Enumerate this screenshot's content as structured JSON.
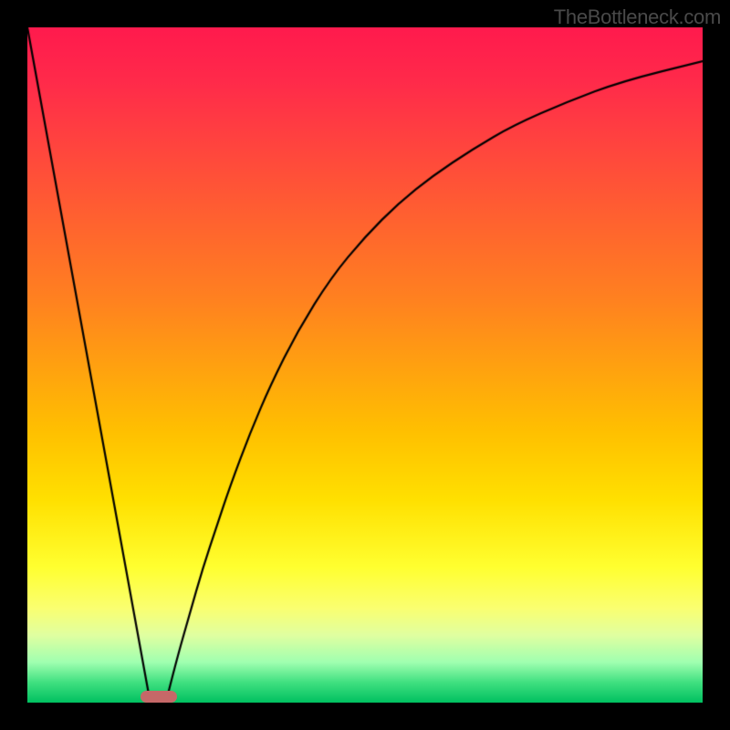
{
  "watermark": "TheBottleneck.com",
  "chart_data": {
    "type": "line",
    "title": "",
    "xlabel": "",
    "ylabel": "",
    "xlim": [
      0,
      100
    ],
    "ylim": [
      0,
      100
    ],
    "grid": false,
    "legend": false,
    "background": "red-to-green-vertical-gradient",
    "series": [
      {
        "name": "left-line",
        "type": "line",
        "x": [
          0,
          18.2
        ],
        "y": [
          100,
          0
        ]
      },
      {
        "name": "right-curve",
        "type": "line",
        "x": [
          20.5,
          22,
          24,
          26,
          28,
          30,
          33,
          36,
          40,
          45,
          50,
          55,
          60,
          66,
          72,
          80,
          88,
          100
        ],
        "y": [
          0,
          6,
          13,
          20,
          26,
          32,
          40,
          47,
          55,
          63,
          69,
          74,
          78,
          82,
          85.5,
          89,
          92,
          95
        ]
      }
    ],
    "marker": {
      "name": "min-marker",
      "shape": "rounded-rect",
      "color": "#c66868",
      "x_center": 19.4,
      "y": 0,
      "width_pct": 5.4,
      "height_pct": 1.8
    }
  }
}
